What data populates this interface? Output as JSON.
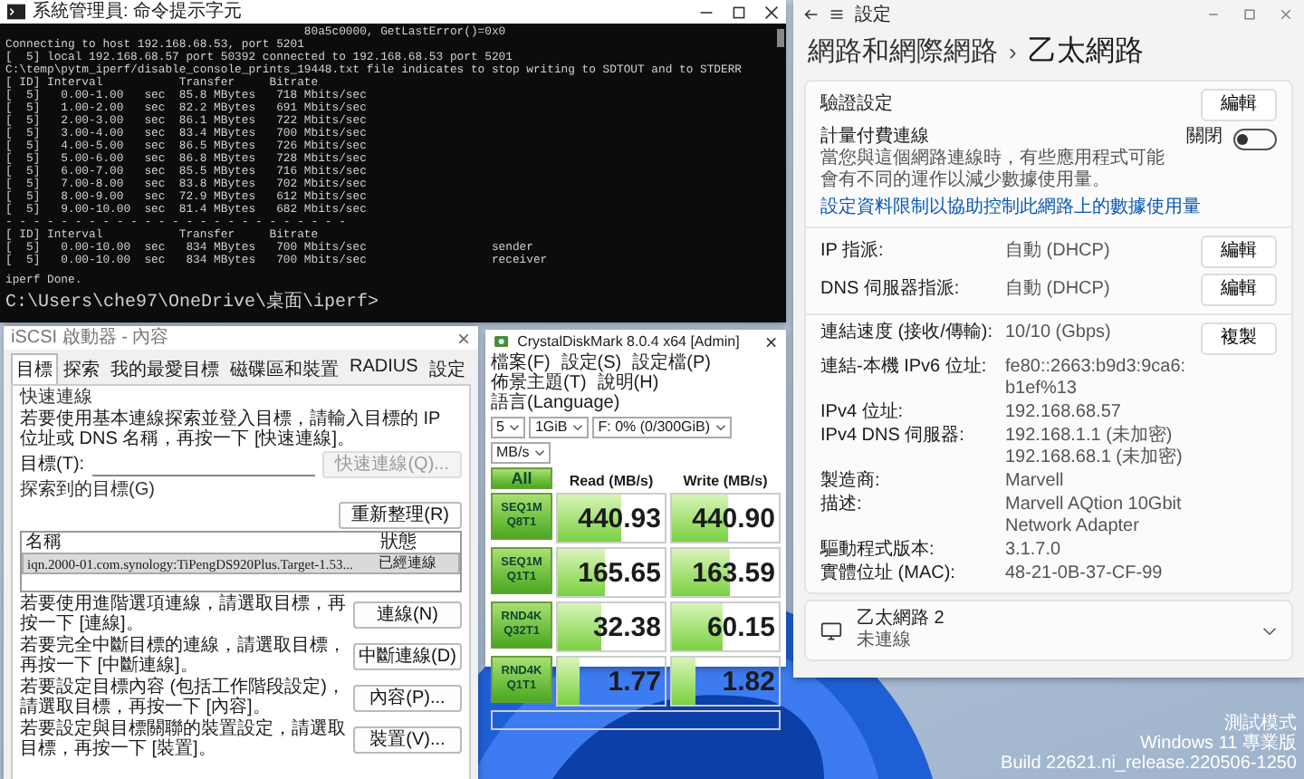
{
  "terminal": {
    "title": "系統管理員: 命令提示字元",
    "lines": [
      "                                           80a5c0000, GetLastError()=0x0",
      "Connecting to host 192.168.68.53, port 5201",
      "[  5] local 192.168.68.57 port 50392 connected to 192.168.68.53 port 5201",
      "C:\\temp\\pytm_iperf/disable_console_prints_19448.txt file indicates to stop writing to SDTOUT and to STDERR",
      "[ ID] Interval           Transfer     Bitrate",
      "[  5]   0.00-1.00   sec  85.8 MBytes   718 Mbits/sec",
      "[  5]   1.00-2.00   sec  82.2 MBytes   691 Mbits/sec",
      "[  5]   2.00-3.00   sec  86.1 MBytes   722 Mbits/sec",
      "[  5]   3.00-4.00   sec  83.4 MBytes   700 Mbits/sec",
      "[  5]   4.00-5.00   sec  86.5 MBytes   726 Mbits/sec",
      "[  5]   5.00-6.00   sec  86.8 MBytes   728 Mbits/sec",
      "[  5]   6.00-7.00   sec  85.5 MBytes   716 Mbits/sec",
      "[  5]   7.00-8.00   sec  83.8 MBytes   702 Mbits/sec",
      "[  5]   8.00-9.00   sec  72.9 MBytes   612 Mbits/sec",
      "[  5]   9.00-10.00  sec  81.4 MBytes   682 Mbits/sec",
      "- - - - - - - - - - - - - - - - - - - - - - - - -",
      "[ ID] Interval           Transfer     Bitrate",
      "[  5]   0.00-10.00  sec   834 MBytes   700 Mbits/sec                  sender",
      "[  5]   0.00-10.00  sec   834 MBytes   700 Mbits/sec                  receiver"
    ],
    "done": "iperf Done.",
    "prompt": "C:\\Users\\che97\\OneDrive\\桌面\\iperf>"
  },
  "iscsi": {
    "title": "iSCSI 啟動器 - 內容",
    "tabs": [
      {
        "label": "目標",
        "selected": true
      },
      {
        "label": "探索",
        "selected": false
      },
      {
        "label": "我的最愛目標",
        "selected": false
      },
      {
        "label": "磁碟區和裝置",
        "selected": false
      },
      {
        "label": "RADIUS",
        "selected": false
      },
      {
        "label": "設定",
        "selected": false
      }
    ],
    "quick_connect": {
      "heading": "快速連線",
      "instructions": "若要使用基本連線探索並登入目標，請輸入目標的 IP 位址或 DNS 名稱，再按一下 [快速連線]。",
      "target_label": "目標(T):",
      "button": {
        "label": "快速連線(Q)...",
        "disabled": true
      }
    },
    "discovered": {
      "heading": "探索到的目標(G)",
      "refresh_button": "重新整理(R)",
      "columns": [
        "名稱",
        "狀態"
      ],
      "rows": [
        {
          "name": "iqn.2000-01.com.synology:TiPengDS920Plus.Target-1.53...",
          "status": "已經連線",
          "selected": true
        }
      ]
    },
    "actions": [
      {
        "text": "若要使用進階選項連線，請選取目標，再按一下 [連線]。",
        "button": "連線(N)"
      },
      {
        "text": "若要完全中斷目標的連線，請選取目標，再按一下 [中斷連線]。",
        "button": "中斷連線(D)"
      },
      {
        "text": "若要設定目標內容 (包括工作階段設定)，請選取目標，再按一下 [內容]。",
        "button": "內容(P)..."
      },
      {
        "text": "若要設定與目標關聯的裝置設定，請選取目標，再按一下 [裝置]。",
        "button": "裝置(V)..."
      }
    ]
  },
  "crystaldiskmark": {
    "title": "CrystalDiskMark 8.0.4 x64 [Admin]",
    "menu": [
      "檔案(F)",
      "設定(S)",
      "設定檔(P)",
      "佈景主題(T)",
      "說明(H)",
      "語言(Language)"
    ],
    "selects": [
      "5",
      "1GiB",
      "F: 0% (0/300GiB)",
      "MB/s"
    ],
    "all_button": "All",
    "columns": [
      "Read (MB/s)",
      "Write (MB/s)"
    ],
    "rows": [
      {
        "test": "SEQ1M",
        "queue": "Q8T1",
        "read": {
          "value": "440.93",
          "level": 0.6
        },
        "write": {
          "value": "440.90",
          "level": 0.52
        }
      },
      {
        "test": "SEQ1M",
        "queue": "Q1T1",
        "read": {
          "value": "165.65",
          "level": 0.44
        },
        "write": {
          "value": "163.59",
          "level": 0.54
        }
      },
      {
        "test": "RND4K",
        "queue": "Q32T1",
        "read": {
          "value": "32.38",
          "level": 0.41
        },
        "write": {
          "value": "60.15",
          "level": 0.47
        }
      },
      {
        "test": "RND4K",
        "queue": "Q1T1",
        "read": {
          "value": "1.77",
          "level": 0.2
        },
        "write": {
          "value": "1.82",
          "level": 0.22
        }
      }
    ]
  },
  "settings": {
    "title": "設定",
    "breadcrumb": {
      "parent": "網路和網際網路",
      "separator": "›",
      "current": "乙太網路"
    },
    "auth": {
      "label": "驗證設定",
      "button": "編輯"
    },
    "metered": {
      "label": "計量付費連線",
      "description": "當您與這個網路連線時，有些應用程式可能會有不同的運作以減少數據使用量。",
      "toggle_label": "關閉",
      "on": false
    },
    "data_limit_link": "設定資料限制以協助控制此網路上的數據使用量",
    "assignments": [
      {
        "label": "IP 指派:",
        "value": "自動 (DHCP)",
        "button": "編輯"
      },
      {
        "label": "DNS 伺服器指派:",
        "value": "自動 (DHCP)",
        "button": "編輯"
      }
    ],
    "copy_button": "複製",
    "properties": [
      {
        "label": "連結速度 (接收/傳輸):",
        "values": [
          "10/10 (Gbps)"
        ]
      },
      {
        "label": "連結-本機 IPv6 位址:",
        "values": [
          "fe80::2663:b9d3:9ca6:b1ef%13"
        ]
      },
      {
        "label": "IPv4 位址:",
        "values": [
          "192.168.68.57"
        ]
      },
      {
        "label": "IPv4 DNS 伺服器:",
        "values": [
          "192.168.1.1 (未加密)",
          "192.168.68.1 (未加密)"
        ]
      },
      {
        "label": "製造商:",
        "values": [
          "Marvell"
        ]
      },
      {
        "label": "描述:",
        "values": [
          "Marvell AQtion 10Gbit Network Adapter"
        ]
      },
      {
        "label": "驅動程式版本:",
        "values": [
          "3.1.7.0"
        ]
      },
      {
        "label": "實體位址 (MAC):",
        "values": [
          "48-21-0B-37-CF-99"
        ]
      }
    ],
    "other_adapter": {
      "name": "乙太網路 2",
      "status": "未連線",
      "expanded": false
    }
  },
  "desktop": {
    "build_info": [
      "測試模式",
      "Windows 11 專業版",
      "Build 22621.ni_release.220506-1250"
    ]
  }
}
